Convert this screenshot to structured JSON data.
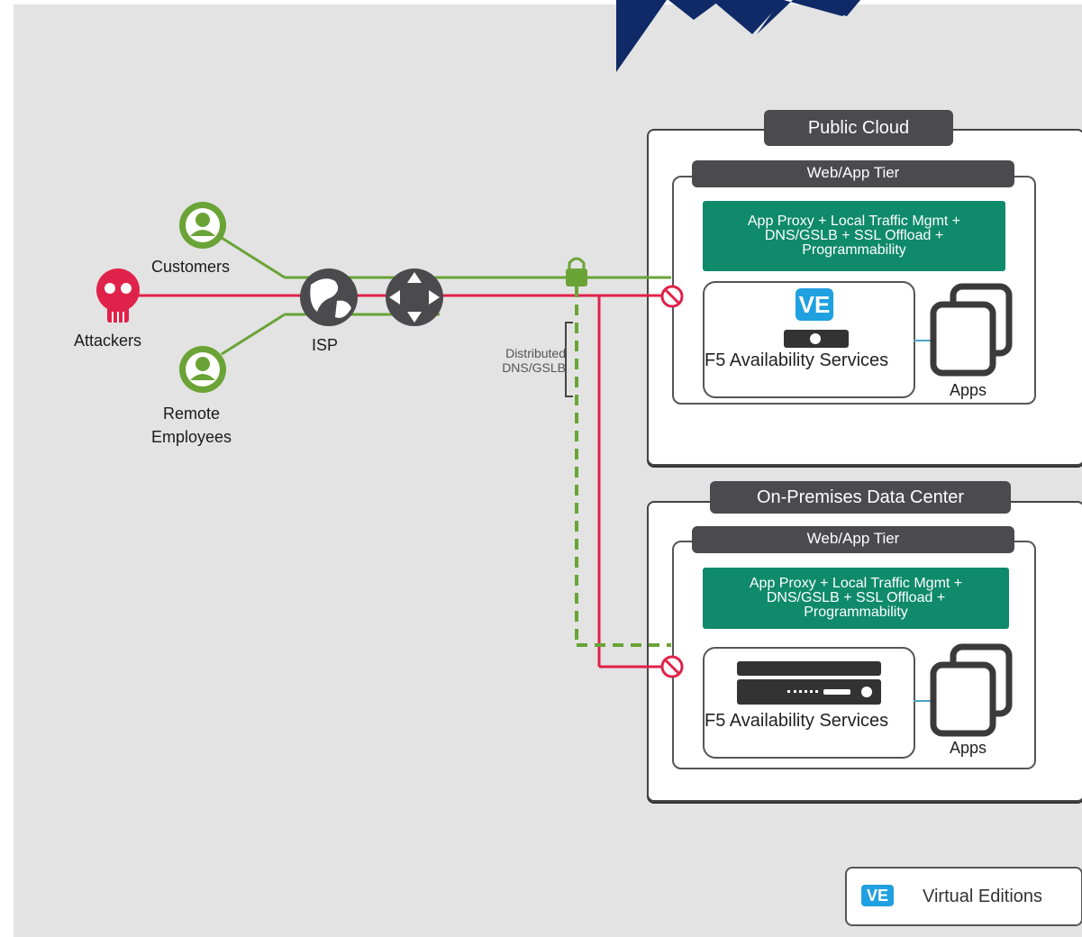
{
  "nodes": {
    "customers": "Customers",
    "attackers": "Attackers",
    "remote_employees": [
      "Remote",
      "Employees"
    ],
    "isp": "ISP",
    "distributed_dns": [
      "Distributed",
      "DNS/GSLB"
    ]
  },
  "public_cloud": {
    "title": "Public Cloud",
    "tier": "Web/App Tier",
    "services": [
      "App Proxy + Local Traffic Mgmt +",
      "DNS/GSLB +  SSL Offload +",
      "Programmability"
    ],
    "f5_label": "F5 Availability  Services",
    "ve_badge": "VE",
    "apps_label": "Apps"
  },
  "on_prem": {
    "title": "On-Premises Data Center",
    "tier": "Web/App Tier",
    "services": [
      "App Proxy + Local Traffic Mgmt +",
      "DNS/GSLB + SSL Offload +",
      "Programmability"
    ],
    "f5_label": "F5 Availability  Services",
    "apps_label": "Apps"
  },
  "legend": {
    "badge": "VE",
    "label": "Virtual Editions"
  },
  "colors": {
    "good_path": "#6aa336",
    "attack_path": "#e0224a",
    "person_icon": "#6aa336",
    "skull_icon": "#e0224a",
    "services_box": "#0f8a6b",
    "tab": "#4b4a4c",
    "ve": "#1fa0e0"
  }
}
